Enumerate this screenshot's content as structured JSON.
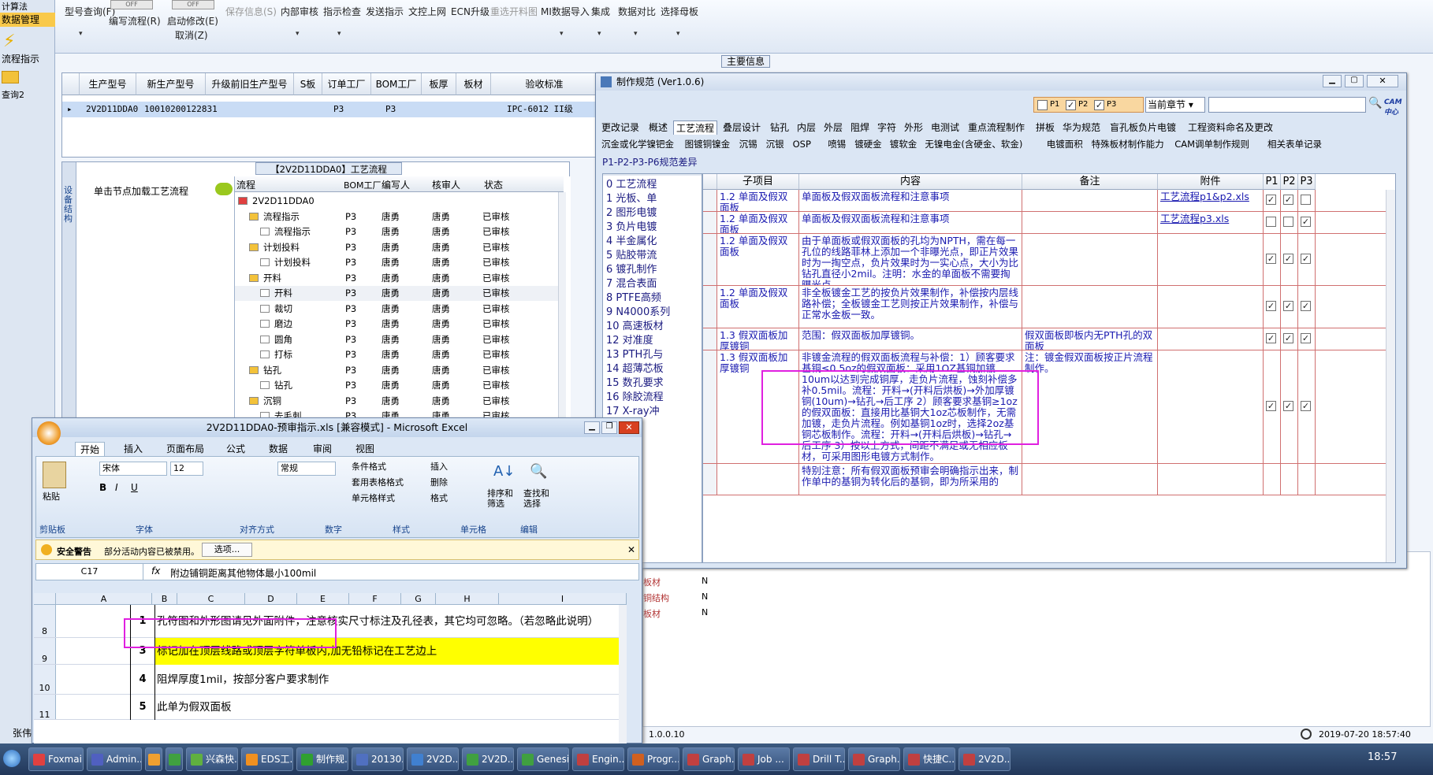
{
  "left_nav": {
    "items": [
      "计算法",
      "数据管理",
      "流程指示",
      "查询2"
    ]
  },
  "toolbar": {
    "items": [
      "型号查询(F)",
      "编写流程(R)",
      "启动修改(E)",
      "取消(Z)",
      "保存信息(S)",
      "内部审核",
      "指示检查",
      "发送指示",
      "文控上网",
      "ECN升级",
      "重选开料图",
      "MI数据导入",
      "集成",
      "数据对比",
      "选择母板"
    ],
    "toggle_off": "OFF"
  },
  "main_info_label": "主要信息",
  "grid1": {
    "headers": [
      "生产型号",
      "新生产型号",
      "升级前旧生产型号",
      "S板",
      "订单工厂",
      "BOM工厂",
      "板厚",
      "板材",
      "验收标准"
    ],
    "row": [
      "2V2D11DDA0",
      "10010200122831",
      "",
      "",
      "P3",
      "P3",
      "",
      "",
      "IPC-6012 II级"
    ]
  },
  "tree": {
    "title": "【2V2D11DDA0】工艺流程",
    "hint": "单击节点加载工艺流程",
    "side_label": "设备结构",
    "headers": [
      "流程",
      "BOM工厂",
      "编写人",
      "核审人",
      "状态"
    ],
    "rows": [
      {
        "name": "2V2D11DDA0",
        "bom": "",
        "author": "",
        "reviewer": "",
        "status": "",
        "lvl": 0
      },
      {
        "name": "流程指示",
        "bom": "P3",
        "author": "唐勇",
        "reviewer": "唐勇",
        "status": "已审核",
        "lvl": 1
      },
      {
        "name": "流程指示",
        "bom": "P3",
        "author": "唐勇",
        "reviewer": "唐勇",
        "status": "已审核",
        "lvl": 2
      },
      {
        "name": "计划投料",
        "bom": "P3",
        "author": "唐勇",
        "reviewer": "唐勇",
        "status": "已审核",
        "lvl": 1
      },
      {
        "name": "计划投料",
        "bom": "P3",
        "author": "唐勇",
        "reviewer": "唐勇",
        "status": "已审核",
        "lvl": 2
      },
      {
        "name": "开料",
        "bom": "P3",
        "author": "唐勇",
        "reviewer": "唐勇",
        "status": "已审核",
        "lvl": 1
      },
      {
        "name": "开料",
        "bom": "P3",
        "author": "唐勇",
        "reviewer": "唐勇",
        "status": "已审核",
        "lvl": 2
      },
      {
        "name": "裁切",
        "bom": "P3",
        "author": "唐勇",
        "reviewer": "唐勇",
        "status": "已审核",
        "lvl": 2
      },
      {
        "name": "磨边",
        "bom": "P3",
        "author": "唐勇",
        "reviewer": "唐勇",
        "status": "已审核",
        "lvl": 2
      },
      {
        "name": "圆角",
        "bom": "P3",
        "author": "唐勇",
        "reviewer": "唐勇",
        "status": "已审核",
        "lvl": 2
      },
      {
        "name": "打标",
        "bom": "P3",
        "author": "唐勇",
        "reviewer": "唐勇",
        "status": "已审核",
        "lvl": 2
      },
      {
        "name": "钻孔",
        "bom": "P3",
        "author": "唐勇",
        "reviewer": "唐勇",
        "status": "已审核",
        "lvl": 1
      },
      {
        "name": "钻孔",
        "bom": "P3",
        "author": "唐勇",
        "reviewer": "唐勇",
        "status": "已审核",
        "lvl": 2
      },
      {
        "name": "沉铜",
        "bom": "P3",
        "author": "唐勇",
        "reviewer": "唐勇",
        "status": "已审核",
        "lvl": 1
      },
      {
        "name": "去毛刺",
        "bom": "P3",
        "author": "唐勇",
        "reviewer": "唐勇",
        "status": "已审核",
        "lvl": 2
      }
    ]
  },
  "spec": {
    "title": "制作规范 (Ver1.0.6)",
    "filters": [
      "P1",
      "P2",
      "P3"
    ],
    "chapter": "当前章节",
    "logo": "CAM中心",
    "tabs_row1": [
      "更改记录",
      "概述",
      "工艺流程",
      "叠层设计",
      "钻孔",
      "内层",
      "外层",
      "阻焊",
      "字符",
      "外形",
      "电测试",
      "重点流程制作",
      "拼板",
      "华为规范",
      "盲孔板负片电镀",
      "工程资料命名及更改"
    ],
    "tabs_row2": [
      "沉金或化学镍钯金",
      "图镀铜镍金",
      "沉锡",
      "沉银",
      "OSP",
      "喷锡",
      "镀硬金",
      "镀软金",
      "无镍电金(含硬金、软金)",
      "电镀面积",
      "特殊板材制作能力",
      "CAM调单制作规则",
      "相关表单记录"
    ],
    "subtitle": "P1-P2-P3-P6规范差异",
    "left_items": [
      "0 工艺流程",
      "1 光板、单",
      "2 图形电镀",
      "3 负片电镀",
      "4 半金属化",
      "5 贴胶带流",
      "6 镀孔制作",
      "7 混合表面",
      "8 PTFE高频",
      "9 N4000系列",
      "10 高速板材",
      "12 对准度",
      "13 PTH孔与",
      "14 超薄芯板",
      "15 数孔要求",
      "16 除胶流程",
      "17 X-ray冲"
    ],
    "headers": [
      "子项目",
      "内容",
      "备注",
      "附件",
      "P1",
      "P2",
      "P3"
    ],
    "rows": [
      {
        "sub": "1.2 单面及假双面板",
        "content": "单面板及假双面板流程和注意事项",
        "note": "",
        "attach": "工艺流程p1&p2.xls",
        "p1": true,
        "p2": true,
        "p3": false
      },
      {
        "sub": "1.2 单面及假双面板",
        "content": "单面板及假双面板流程和注意事项",
        "note": "",
        "attach": "工艺流程p3.xls",
        "p1": false,
        "p2": false,
        "p3": true
      },
      {
        "sub": "1.2 单面及假双面板",
        "content": "由于单面板或假双面板的孔均为NPTH，需在每一孔位的线路菲林上添加一个非曝光点，即正片效果时为一掏空点，负片效果时为一实心点，大小为比钻孔直径小2mil。注明：水金的单面板不需要掏曝光点。",
        "note": "",
        "attach": "",
        "p1": true,
        "p2": true,
        "p3": true
      },
      {
        "sub": "1.2 单面及假双面板",
        "content": "非全板镀金工艺的按负片效果制作，补偿按内层线路补偿；全板镀金工艺则按正片效果制作，补偿与正常水金板一致。",
        "note": "",
        "attach": "",
        "p1": true,
        "p2": true,
        "p3": true
      },
      {
        "sub": "1.3 假双面板加厚镀铜",
        "content": "范围：假双面板加厚镀铜。",
        "note": "假双面板即板内无PTH孔的双面板",
        "attach": "",
        "p1": true,
        "p2": true,
        "p3": true
      },
      {
        "sub": "1.3 假双面板加厚镀铜",
        "content": "非镀金流程的假双面板流程与补偿：1）顾客要求基铜≤0.5oz的假双面板：采用1OZ基铜加镀10um以达到完成铜厚，走负片流程，蚀刻补偿多补0.5mil。流程：开料→(开料后烘板)→外加厚镀铜(10um)→钻孔→后工序 2）顾客要求基铜≥1oz的假双面板：直接用比基铜大1oz芯板制作，无需加镀，走负片流程。例如基铜1oz时，选择2oz基铜芯板制作。流程：开料→(开料后烘板)→钻孔→后工序 3）按以上方式，间距不满足或无相应板材，可采用图形电镀方式制作。",
        "note": "注：镀金假双面板按正片流程制作。",
        "attach": "",
        "p1": true,
        "p2": true,
        "p3": true
      },
      {
        "sub": "",
        "content": "特别注意：所有假双面板预审会明确指示出来，制作单中的基铜为转化后的基铜，即为所采用的",
        "note": "",
        "attach": "",
        "p1": false,
        "p2": false,
        "p3": false
      }
    ]
  },
  "props": [
    {
      "k": "板材",
      "v": "N"
    },
    {
      "k": "铜结构",
      "v": "N"
    },
    {
      "k": "板材",
      "v": "N"
    }
  ],
  "status": {
    "version": "1.0.0.10",
    "datetime": "2019-07-20 18:57:40",
    "user": "张伟"
  },
  "excel": {
    "title": "2V2D11DDA0-预审指示.xls [兼容模式] - Microsoft Excel",
    "tabs": [
      "开始",
      "插入",
      "页面布局",
      "公式",
      "数据",
      "审阅",
      "视图"
    ],
    "font": "宋体",
    "size": "12",
    "numfmt": "常规",
    "ribbon": {
      "paste": "粘贴",
      "cond": "条件格式",
      "tablefmt": "套用表格格式",
      "cellstyle": "单元格样式",
      "insert": "插入",
      "delete": "删除",
      "format": "格式",
      "sort": "排序和筛选",
      "find": "查找和选择"
    },
    "sections": [
      "剪贴板",
      "字体",
      "对齐方式",
      "数字",
      "样式",
      "单元格",
      "编辑"
    ],
    "security": {
      "label": "安全警告",
      "msg": "部分活动内容已被禁用。",
      "btn": "选项..."
    },
    "cellref": "C17",
    "formula": "附边铺铜距离其他物体最小100mil",
    "cols": [
      "A",
      "B",
      "C",
      "D",
      "E",
      "F",
      "G",
      "H",
      "I"
    ],
    "rows": [
      {
        "rn": "8",
        "b": "1",
        "c": "孔符图和外形图请见外面附件，注意核实尺寸标注及孔径表，其它均可忽略。（若忽略此说明）",
        "hl": false
      },
      {
        "rn": "9",
        "b": "3",
        "c": "标记加在顶层线路或顶层字符单板内,加无铅标记在工艺边上",
        "hl": true
      },
      {
        "rn": "10",
        "b": "4",
        "c": "阻焊厚度1mil，按部分客户要求制作",
        "hl": false
      },
      {
        "rn": "11",
        "b": "5",
        "c": "此单为假双面板",
        "hl": false
      }
    ]
  },
  "taskbar": {
    "tasks": [
      "Foxmail",
      "Admin...",
      "",
      "",
      "兴森快...",
      "EDS工...",
      "制作规...",
      "20130...",
      "2V2D...",
      "2V2D...",
      "Genesis",
      "Engin...",
      "Progr...",
      "Graph...",
      "Job ...",
      "Drill T...",
      "Graph...",
      "快捷C...",
      "2V2D..."
    ],
    "clock": "18:57"
  },
  "colors": {
    "highlight": "#ffff00",
    "magenta": "#e020e0",
    "row_text": "#1a1ab0",
    "grid_red": "#d07070"
  }
}
